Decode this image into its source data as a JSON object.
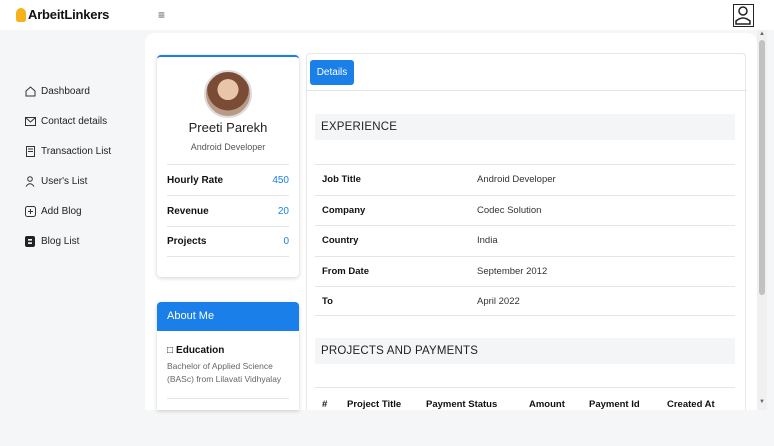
{
  "app": {
    "name": "ArbeitLinkers"
  },
  "header": {
    "menu_icon": "≡",
    "user_icon": "user-icon"
  },
  "sidebar": {
    "items": [
      {
        "label": "Dashboard",
        "icon": "home-icon"
      },
      {
        "label": "Contact details",
        "icon": "mail-icon"
      },
      {
        "label": "Transaction List",
        "icon": "document-icon"
      },
      {
        "label": "User's List",
        "icon": "person-icon"
      },
      {
        "label": "Add Blog",
        "icon": "plus-square-icon"
      },
      {
        "label": "Blog List",
        "icon": "blogger-icon"
      }
    ]
  },
  "profile": {
    "name": "Preeti Parekh",
    "role": "Android Developer",
    "stats": [
      {
        "label": "Hourly Rate",
        "value": "450"
      },
      {
        "label": "Revenue",
        "value": "20"
      },
      {
        "label": "Projects",
        "value": "0"
      }
    ]
  },
  "about": {
    "title": "About Me",
    "education_title": "Education",
    "education_icon": "□",
    "education_text": "Bachelor of Applied Science (BASc) from Lilavati Vidhyalay"
  },
  "details": {
    "tab_label": "Details",
    "experience_title": "EXPERIENCE",
    "experience": [
      {
        "label": "Job Title",
        "value": "Android Developer"
      },
      {
        "label": "Company",
        "value": "Codec Solution"
      },
      {
        "label": "Country",
        "value": "India"
      },
      {
        "label": "From Date",
        "value": "September 2012"
      },
      {
        "label": "To",
        "value": "April 2022"
      }
    ],
    "projects_title": "PROJECTS AND PAYMENTS",
    "projects_columns": [
      "#",
      "Project Title",
      "Payment Status",
      "Amount",
      "Payment Id",
      "Created At"
    ]
  },
  "colors": {
    "accent": "#1a7fe8",
    "logo": "#f6b21b"
  }
}
